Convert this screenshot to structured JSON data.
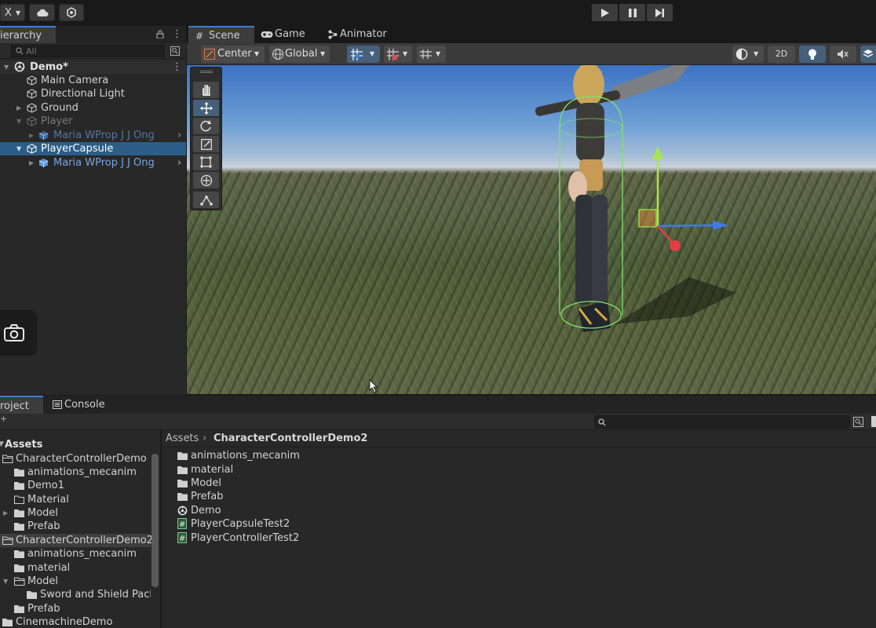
{
  "topbar": {
    "account_label": "X",
    "play": "play-icon",
    "pause": "pause-icon",
    "step": "step-icon"
  },
  "hierarchy": {
    "tab_label": "ierarchy",
    "search_placeholder": "All",
    "scene_name": "Demo*",
    "items": [
      {
        "label": "Main Camera"
      },
      {
        "label": "Directional Light"
      },
      {
        "label": "Ground"
      },
      {
        "label": "Player"
      },
      {
        "label": "Maria WProp J J Ong"
      },
      {
        "label": "PlayerCapsule"
      },
      {
        "label": "Maria WProp J J Ong"
      }
    ]
  },
  "scene": {
    "tabs": [
      {
        "label": "Scene"
      },
      {
        "label": "Game"
      },
      {
        "label": "Animator"
      }
    ],
    "pivot_label": "Center",
    "space_label": "Global",
    "mode_2d": "2D"
  },
  "bottom": {
    "tabs": [
      {
        "label": "roject"
      },
      {
        "label": "Console"
      }
    ]
  },
  "project": {
    "root_label": "Assets",
    "tree": [
      {
        "label": "CharacterControllerDemo"
      },
      {
        "label": "animations_mecanim"
      },
      {
        "label": "Demo1"
      },
      {
        "label": "Material"
      },
      {
        "label": "Model"
      },
      {
        "label": "Prefab"
      },
      {
        "label": "CharacterControllerDemo2"
      },
      {
        "label": "animations_mecanim"
      },
      {
        "label": "material"
      },
      {
        "label": "Model"
      },
      {
        "label": "Sword and Shield Pacl"
      },
      {
        "label": "Prefab"
      },
      {
        "label": "CinemachineDemo"
      }
    ],
    "breadcrumb": [
      "Assets",
      "CharacterControllerDemo2"
    ],
    "files": [
      {
        "label": "animations_mecanim",
        "icon": "folder-icon"
      },
      {
        "label": "material",
        "icon": "folder-icon"
      },
      {
        "label": "Model",
        "icon": "folder-icon"
      },
      {
        "label": "Prefab",
        "icon": "folder-icon"
      },
      {
        "label": "Demo",
        "icon": "unity-scene-icon"
      },
      {
        "label": "PlayerCapsuleTest2",
        "icon": "csharp-script-icon"
      },
      {
        "label": "PlayerControllerTest2",
        "icon": "csharp-script-icon"
      }
    ]
  },
  "colors": {
    "selection": "#2c5d87",
    "accent": "#3a7fd5",
    "prefab_blue": "#7aa6e0"
  }
}
